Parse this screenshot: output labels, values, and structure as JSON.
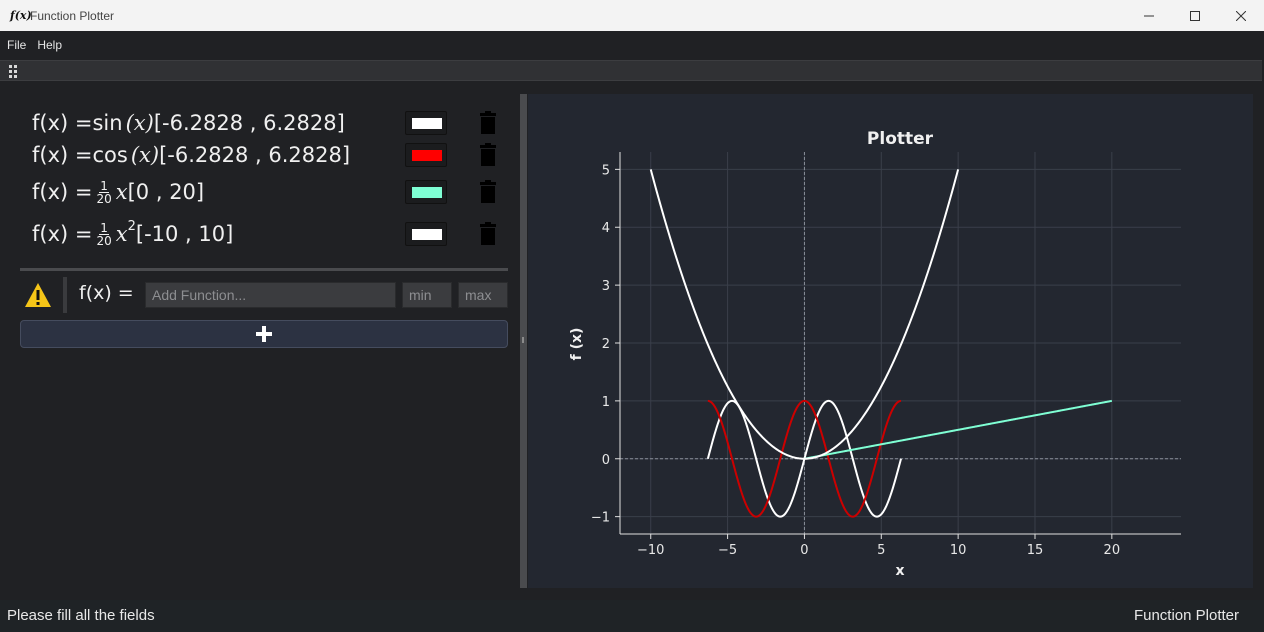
{
  "window": {
    "title": "Function Plotter",
    "app_icon_text": "f(x)",
    "controls": [
      "minimize",
      "maximize",
      "close"
    ]
  },
  "menu": {
    "items": [
      "File",
      "Help"
    ]
  },
  "functions": [
    {
      "prefix": "f(x) = ",
      "expr": "sin",
      "arg": "(x)",
      "range": " [-6.2828 , 6.2828]",
      "color": "#ffffff"
    },
    {
      "prefix": "f(x) = ",
      "expr": "cos",
      "arg": "(x)",
      "range": " [-6.2828 , 6.2828]",
      "color": "#ff0000"
    },
    {
      "prefix": "f(x) = ",
      "frac_num": "1",
      "frac_den": "20",
      "var": "x",
      "range": " [0 , 20]",
      "color": "#7fffd4"
    },
    {
      "prefix": "f(x) = ",
      "frac_num": "1",
      "frac_den": "20",
      "var": "x",
      "exp": "2",
      "range": " [-10 , 10]",
      "color": "#ffffff"
    }
  ],
  "input_row": {
    "label": "f(x) =",
    "function_placeholder": "Add Function...",
    "min_placeholder": "min",
    "max_placeholder": "max",
    "warning_icon": "warning-icon",
    "add_icon": "plus-icon"
  },
  "status": {
    "message": "Please fill all the fields",
    "app_name": "Function Plotter"
  },
  "chart_data": {
    "type": "line",
    "title": "Plotter",
    "xlabel": "x",
    "ylabel": "f (x)",
    "xlim": [
      -12,
      24.5
    ],
    "ylim": [
      -1.3,
      5.3
    ],
    "xticks": [
      -10,
      -5,
      0,
      5,
      10,
      15,
      20
    ],
    "xtick_labels": [
      "−10",
      "−5",
      "0",
      "5",
      "10",
      "15",
      "20"
    ],
    "yticks": [
      -1,
      0,
      1,
      2,
      3,
      4,
      5
    ],
    "ytick_labels": [
      "−1",
      "0",
      "1",
      "2",
      "3",
      "4",
      "5"
    ],
    "grid": true,
    "series": [
      {
        "function": "sin(x)",
        "x_range": [
          -6.2828,
          6.2828
        ],
        "color": "#ffffff"
      },
      {
        "function": "cos(x)",
        "x_range": [
          -6.2828,
          6.2828
        ],
        "color": "#cc0000"
      },
      {
        "function": "x/20",
        "x_range": [
          0,
          20
        ],
        "color": "#7fffd4"
      },
      {
        "function": "x^2/20",
        "x_range": [
          -10,
          10
        ],
        "color": "#ffffff"
      }
    ]
  }
}
